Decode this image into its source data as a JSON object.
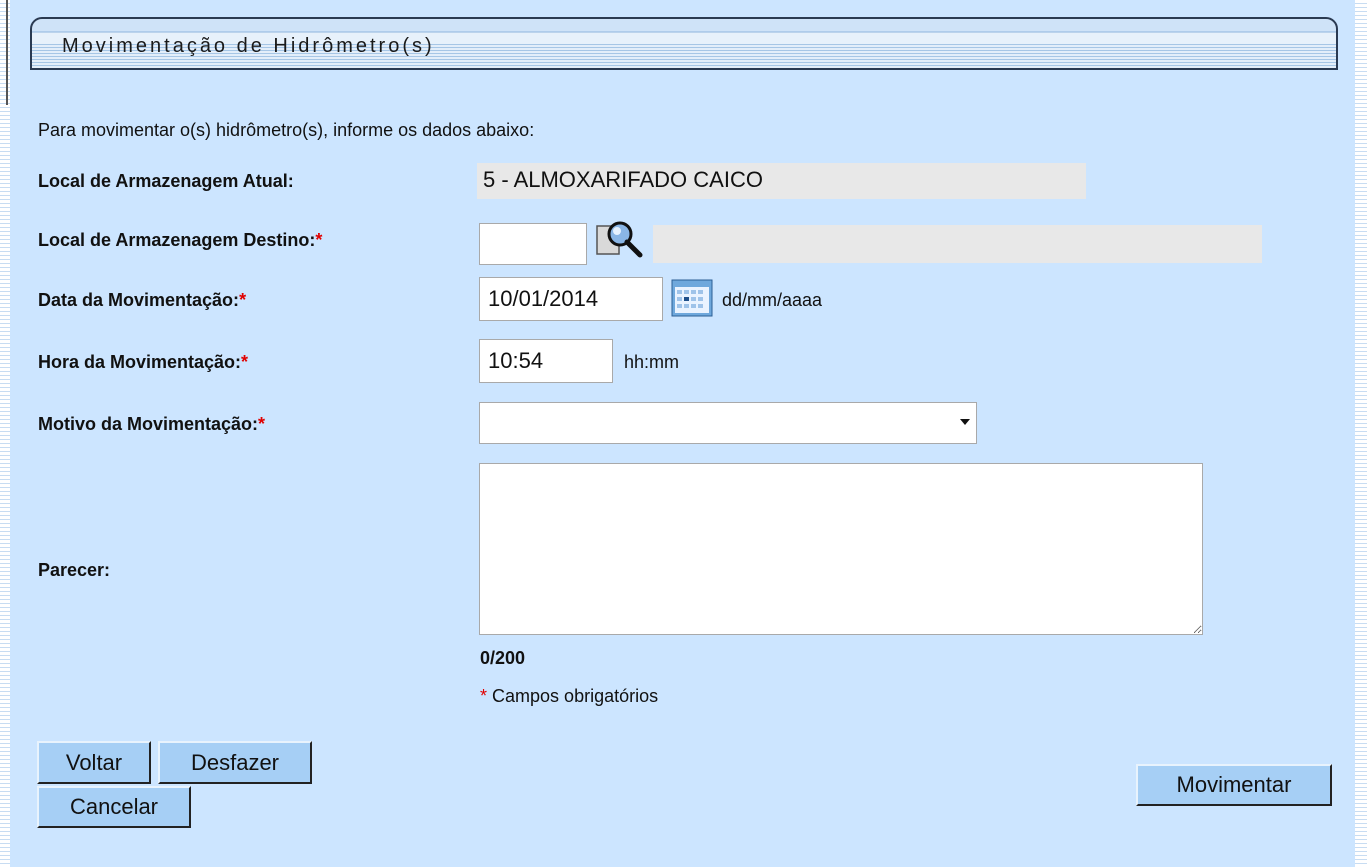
{
  "header": {
    "title": "Movimentação de Hidrômetro(s)"
  },
  "intro_text": "Para movimentar o(s) hidrômetro(s), informe os dados abaixo:",
  "fields": {
    "local_atual": {
      "label": "Local de Armazenagem Atual:",
      "value": "5 - ALMOXARIFADO CAICO"
    },
    "local_destino": {
      "label": "Local de Armazenagem Destino:",
      "required_mark": "*",
      "code_value": "",
      "description_value": ""
    },
    "data": {
      "label": "Data da Movimentação:",
      "required_mark": "*",
      "value": "10/01/2014",
      "format_hint": "dd/mm/aaaa"
    },
    "hora": {
      "label": "Hora da Movimentação:",
      "required_mark": "*",
      "value": "10:54",
      "format_hint": "hh:mm"
    },
    "motivo": {
      "label": "Motivo da Movimentação:",
      "required_mark": "*",
      "selected": ""
    },
    "parecer": {
      "label": "Parecer:",
      "value": "",
      "char_count": "0/200"
    }
  },
  "required_note": {
    "mark": "*",
    "text": "Campos obrigatórios"
  },
  "buttons": {
    "voltar": "Voltar",
    "desfazer": "Desfazer",
    "cancelar": "Cancelar",
    "movimentar": "Movimentar"
  },
  "icons": {
    "search": "magnifier-icon",
    "calendar": "calendar-icon",
    "dropdown": "chevron-down-icon"
  },
  "colors": {
    "background": "#cce5ff",
    "button": "#a6cff5",
    "required": "#e00000"
  }
}
